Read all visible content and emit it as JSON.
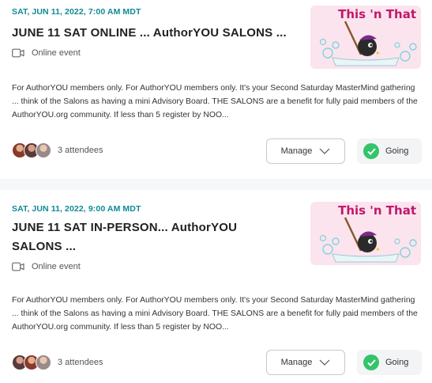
{
  "events": [
    {
      "date": "SAT, JUN 11, 2022, 7:00 AM MDT",
      "title": "JUNE 11 SAT ONLINE ... AuthorYOU SALONS ...",
      "location": "Online event",
      "description": "For AuthorYOU members only. For AuthorYOU members only. It's your Second Saturday MasterMind gathering ... think of the Salons as having a mini Advisory Board. THE SALONS are a benefit for fully paid members of the AuthorYOU.org community. If less than 5 register by NOO...",
      "image_text": "This 'n That",
      "attendees": "3 attendees",
      "manage_label": "Manage",
      "status_label": "Going"
    },
    {
      "date": "SAT, JUN 11, 2022, 9:00 AM MDT",
      "title": "JUNE 11 SAT IN-PERSON... AuthorYOU SALONS ...",
      "location": "Online event",
      "description": "For AuthorYOU members only. For AuthorYOU members only. It's your Second Saturday MasterMind gathering ... think of the Salons as having a mini Advisory Board. THE SALONS are a benefit for fully paid members of the AuthorYOU.org community. If less than 5 register by NOO...",
      "image_text": "This 'n That",
      "attendees": "3 attendees",
      "manage_label": "Manage",
      "status_label": "Going"
    }
  ],
  "colors": {
    "date": "#0d8a96",
    "going_check": "#34c46a"
  },
  "icons": {
    "location": "video-camera-icon",
    "manage": "chevron-down-icon",
    "status": "check-circle-icon"
  }
}
